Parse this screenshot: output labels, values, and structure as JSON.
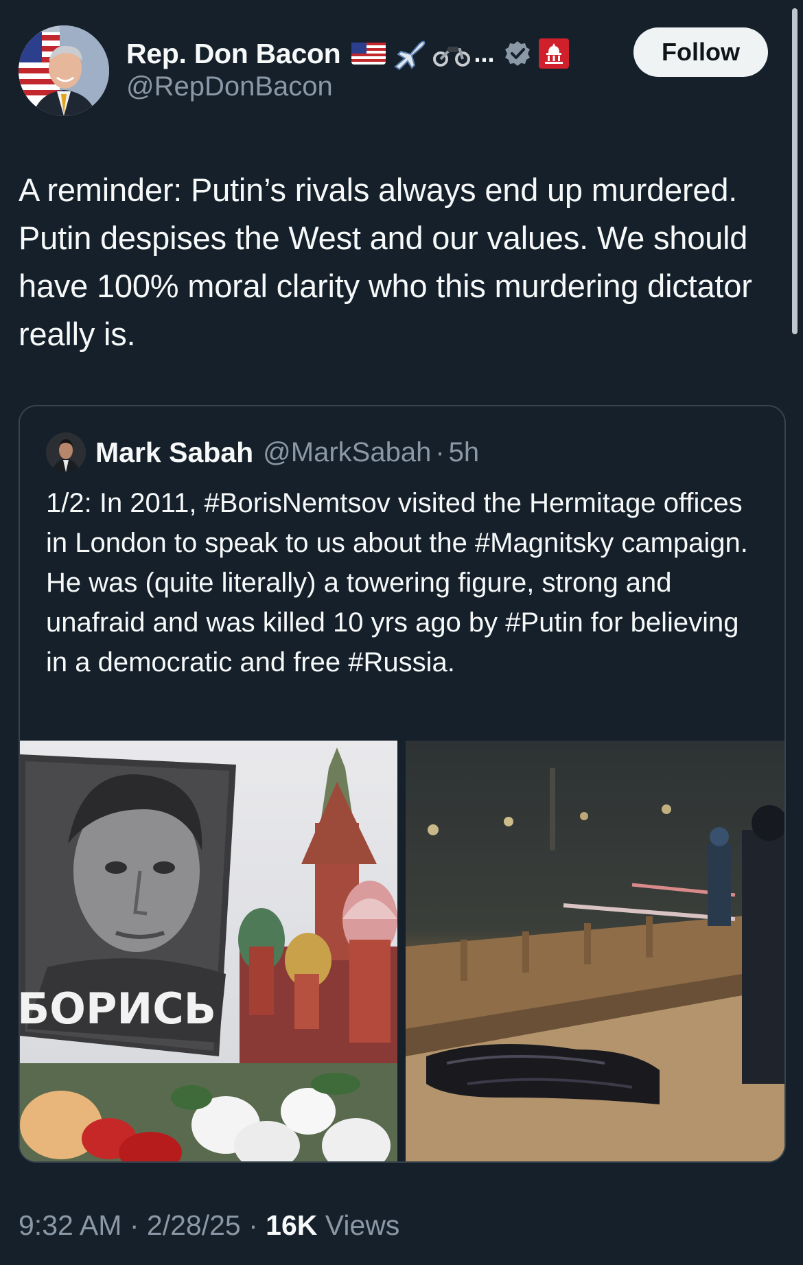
{
  "author": {
    "display_name": "Rep. Don Bacon",
    "name_emojis": [
      "us-flag-emoji",
      "airplane-emoji",
      "motorcycle-emoji"
    ],
    "name_overflow": "...",
    "handle": "@RepDonBacon",
    "verified_icon": "verified-badge-icon",
    "affiliate_badge": "capitol-affiliate-badge-icon",
    "verified_color": "#8b98a5",
    "badge_color": "#d0202b"
  },
  "follow_button": {
    "label": "Follow"
  },
  "tweet": {
    "text": "A reminder: Putin’s rivals always end up murdered. Putin despises the West and our values. We should have 100% moral clarity who this murdering dictator really is."
  },
  "quote": {
    "display_name": "Mark Sabah",
    "handle": "@MarkSabah",
    "separator": "·",
    "time": "5h",
    "text": "1/2: In 2011, #BorisNemtsov visited the Hermitage offices in London to speak to us about the #Magnitsky campaign. He was (quite literally) a towering figure, strong and unafraid and was killed 10 yrs ago by #Putin for believing in a democratic and free #Russia.",
    "media": [
      {
        "kind": "photo",
        "poster_text": "БОРИСЬ"
      },
      {
        "kind": "photo"
      }
    ]
  },
  "footer": {
    "time": "9:32 AM",
    "separator": "·",
    "date": "2/28/25",
    "views_count": "16K",
    "views_label": "Views"
  },
  "colors": {
    "background": "#15202b",
    "text_primary": "#f7f9f9",
    "text_secondary": "#8b98a5",
    "border": "#38444d",
    "follow_bg": "#eff3f4"
  }
}
